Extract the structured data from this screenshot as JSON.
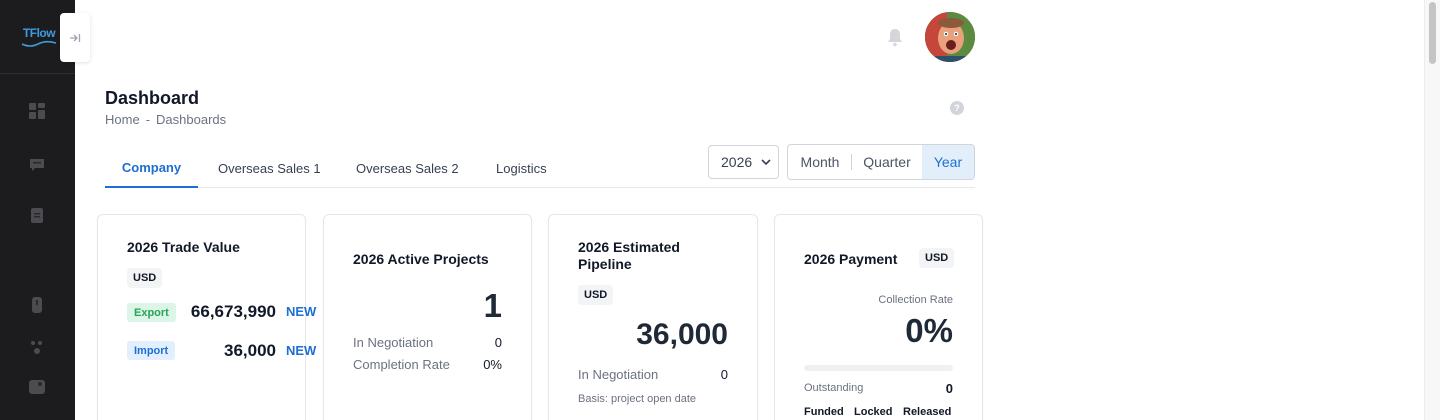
{
  "app": {
    "logo_text": "TFlow"
  },
  "header": {
    "title": "Dashboard",
    "breadcrumb": [
      "Home",
      "-",
      "Dashboards"
    ],
    "help": "?"
  },
  "tabs": [
    {
      "label": "Company",
      "active": true
    },
    {
      "label": "Overseas Sales 1",
      "active": false
    },
    {
      "label": "Overseas Sales 2",
      "active": false
    },
    {
      "label": "Logistics",
      "active": false
    }
  ],
  "filters": {
    "year": "2026",
    "periods": [
      "Month",
      "Quarter",
      "Year"
    ],
    "selected_period": "Year"
  },
  "cards": {
    "trade_value": {
      "title": "2026 Trade Value",
      "currency": "USD",
      "export_label": "Export",
      "export_value": "66,673,990",
      "import_label": "Import",
      "import_value": "36,000",
      "new_label": "NEW"
    },
    "active_projects": {
      "title": "2026 Active Projects",
      "count": "1",
      "negotiation_label": "In Negotiation",
      "negotiation_value": "0",
      "completion_label": "Completion Rate",
      "completion_value": "0%"
    },
    "pipeline": {
      "title_line1": "2026 Estimated",
      "title_line2": "Pipeline",
      "currency": "USD",
      "value": "36,000",
      "negotiation_label": "In Negotiation",
      "negotiation_value": "0",
      "basis": "Basis: project open date"
    },
    "payment": {
      "title": "2026 Payment",
      "currency": "USD",
      "collection_label": "Collection Rate",
      "collection_rate": "0%",
      "collection_fraction": 0,
      "outstanding_label": "Outstanding",
      "outstanding_value": "0",
      "footer": [
        "Funded",
        "Locked",
        "Released"
      ]
    }
  },
  "colors": {
    "sidebar_bg": "#1c1c1e",
    "accent": "#1d6fd1",
    "export_green": "#23a55a"
  },
  "icons": {
    "sidebar": [
      "dashboard-icon",
      "chat-icon",
      "document-icon",
      "user-icon",
      "team-icon",
      "gallery-icon"
    ],
    "topbar": [
      "bell-icon",
      "avatar"
    ]
  }
}
